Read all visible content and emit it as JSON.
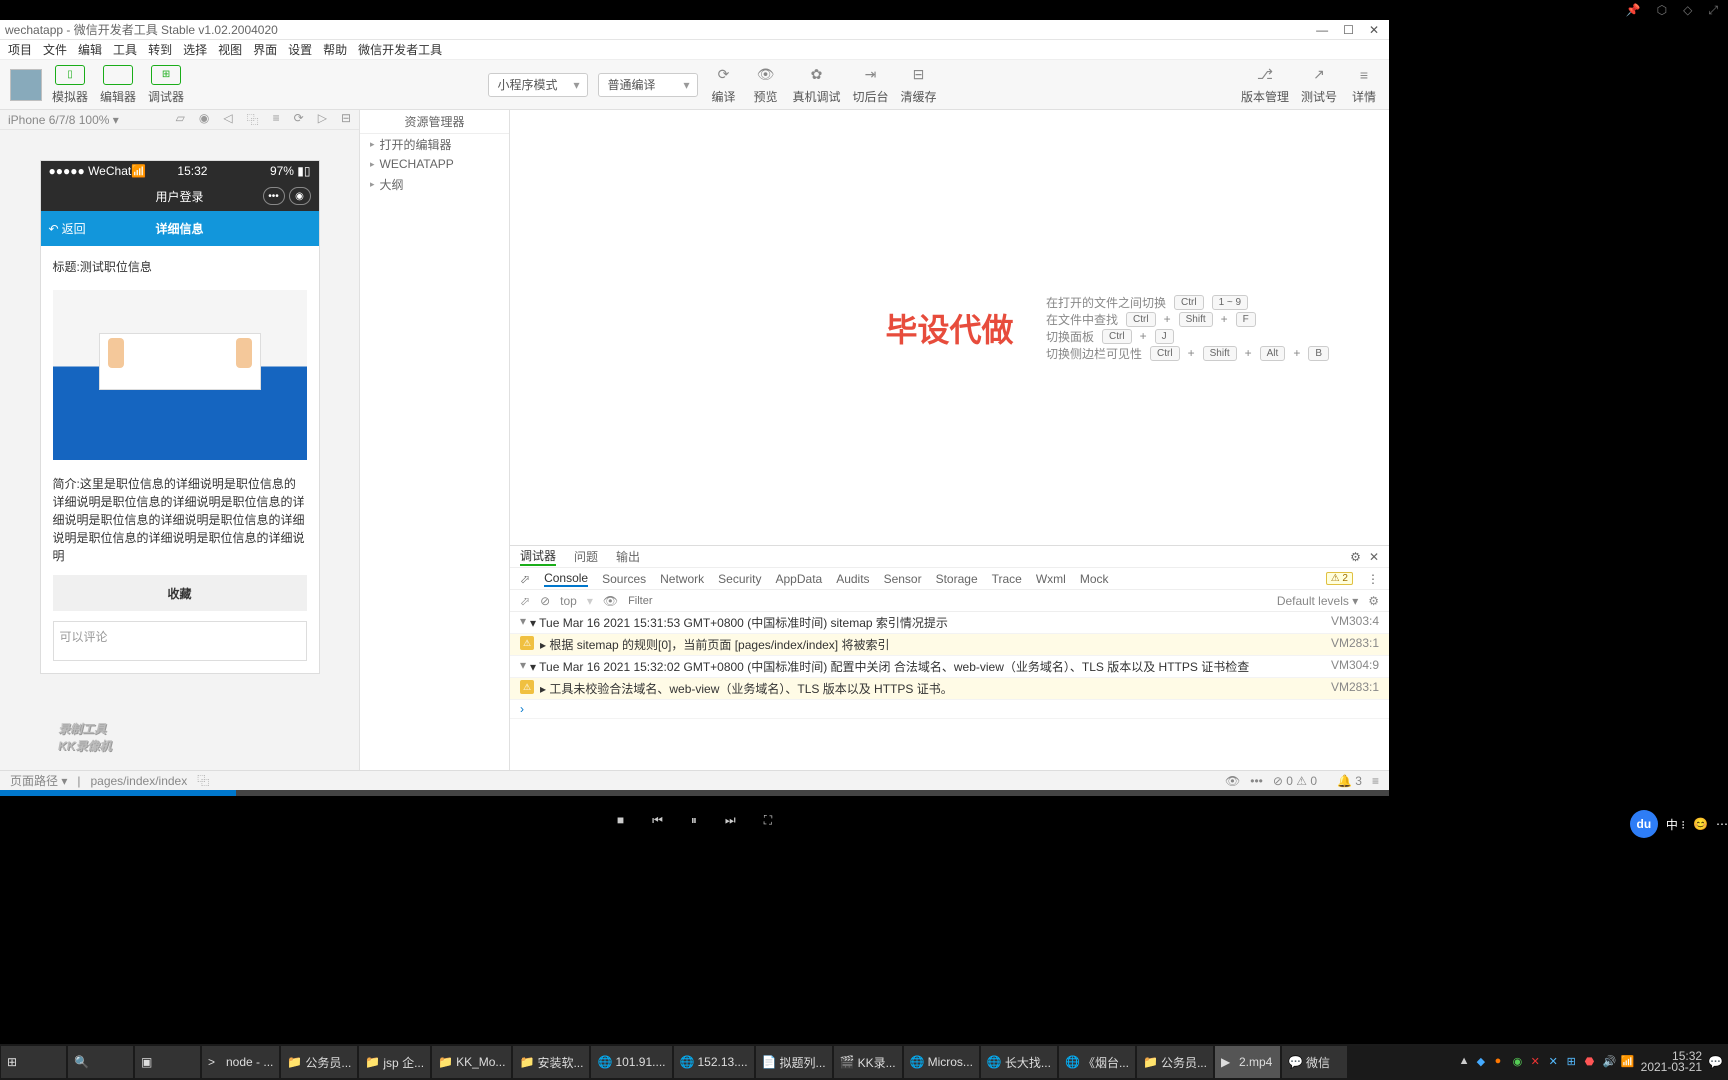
{
  "topbar_icons": [
    "📌",
    "⬡",
    "⬒",
    "↗"
  ],
  "titlebar": {
    "title": "wechatapp - 微信开发者工具 Stable v1.02.2004020"
  },
  "menubar": [
    "项目",
    "文件",
    "编辑",
    "工具",
    "转到",
    "选择",
    "视图",
    "界面",
    "设置",
    "帮助",
    "微信开发者工具"
  ],
  "toolbar_left": [
    {
      "icon": "▯",
      "label": "模拟器"
    },
    {
      "icon": "</>",
      "label": "编辑器"
    },
    {
      "icon": "⊞",
      "label": "调试器"
    }
  ],
  "mode_dd": "小程序模式",
  "compile_dd": "普通编译",
  "toolbar_mid": [
    {
      "icon": "⟳",
      "label": "编译"
    },
    {
      "icon": "👁",
      "label": "预览"
    },
    {
      "icon": "✿",
      "label": "真机调试"
    },
    {
      "icon": "⇥",
      "label": "切后台"
    },
    {
      "icon": "⊟",
      "label": "清缓存"
    }
  ],
  "toolbar_right": [
    {
      "icon": "⎇",
      "label": "版本管理"
    },
    {
      "icon": "↗",
      "label": "测试号"
    },
    {
      "icon": "≡",
      "label": "详情"
    }
  ],
  "sim": {
    "device": "iPhone 6/7/8 100% ▾"
  },
  "phone": {
    "carrier": "●●●●● WeChat📶",
    "time": "15:32",
    "battery": "97% ▮▯",
    "nav_title": "用户登录",
    "blue_back": "返回",
    "blue_title": "详细信息",
    "content_title": "标题:测试职位信息",
    "content_desc": "简介:这里是职位信息的详细说明是职位信息的详细说明是职位信息的详细说明是职位信息的详细说明是职位信息的详细说明是职位信息的详细说明是职位信息的详细说明是职位信息的详细说明",
    "fav": "收藏",
    "comment_ph": "可以评论"
  },
  "explorer": {
    "head": "资源管理器",
    "items": [
      "打开的编辑器",
      "WECHATAPP",
      "大纲"
    ]
  },
  "editor_hints": [
    {
      "text": "在打开的文件之间切换",
      "keys": [
        "Ctrl",
        "1 ~ 9"
      ]
    },
    {
      "text": "在文件中查找",
      "keys": [
        "Ctrl",
        "+",
        "Shift",
        "+",
        "F"
      ]
    },
    {
      "text": "切换面板",
      "keys": [
        "Ctrl",
        "+",
        "J"
      ]
    },
    {
      "text": "切换侧边栏可见性",
      "keys": [
        "Ctrl",
        "+",
        "Shift",
        "+",
        "Alt",
        "+",
        "B"
      ]
    }
  ],
  "watermark": "毕设代做",
  "debugger": {
    "tabs1": [
      "调试器",
      "问题",
      "输出"
    ],
    "tabs2": [
      "Console",
      "Sources",
      "Network",
      "Security",
      "AppData",
      "Audits",
      "Sensor",
      "Storage",
      "Trace",
      "Wxml",
      "Mock"
    ],
    "warn_count": "⚠ 2",
    "context": "top",
    "filter_ph": "Filter",
    "levels": "Default levels ▾",
    "logs": [
      {
        "type": "info",
        "msg": "▾ Tue Mar 16 2021 15:31:53 GMT+0800 (中国标准时间) sitemap 索引情况提示",
        "src": "VM303:4"
      },
      {
        "type": "warn",
        "msg": "▸ 根据 sitemap 的规则[0]，当前页面 [pages/index/index] 将被索引",
        "src": "VM283:1"
      },
      {
        "type": "info",
        "msg": "▾ Tue Mar 16 2021 15:32:02 GMT+0800 (中国标准时间) 配置中关闭 合法域名、web-view（业务域名）、TLS 版本以及 HTTPS 证书检查",
        "src": "VM304:9"
      },
      {
        "type": "warn",
        "msg": "▸ 工具未校验合法域名、web-view（业务域名）、TLS 版本以及 HTTPS 证书。",
        "src": "VM283:1"
      }
    ]
  },
  "statusbar": {
    "left": "页面路径 ▾",
    "path": "pages/index/index",
    "counts": "⊘ 0 ⚠ 0",
    "bell": "🔔 3"
  },
  "rec_watermark1": "录制工具",
  "rec_watermark2": "KK录像机",
  "video_ctrl": [
    "■",
    "⏮",
    "⏸",
    "⏭",
    "⛶"
  ],
  "float": {
    "du": "du",
    "ime": "中 ⁝",
    "emoji": "😊",
    "more": "⋯"
  },
  "taskbar": [
    {
      "ic": "⊞",
      "label": ""
    },
    {
      "ic": "🔍",
      "label": ""
    },
    {
      "ic": "▣",
      "label": ""
    },
    {
      "ic": ">",
      "label": "node - ..."
    },
    {
      "ic": "📁",
      "label": "公务员..."
    },
    {
      "ic": "📁",
      "label": "jsp 企..."
    },
    {
      "ic": "📁",
      "label": "KK_Mo..."
    },
    {
      "ic": "📁",
      "label": "安装软..."
    },
    {
      "ic": "🌐",
      "label": "101.91...."
    },
    {
      "ic": "🌐",
      "label": "152.13...."
    },
    {
      "ic": "📄",
      "label": "拟题列..."
    },
    {
      "ic": "🎬",
      "label": "KK录..."
    },
    {
      "ic": "🌐",
      "label": "Micros..."
    },
    {
      "ic": "🌐",
      "label": "长大找..."
    },
    {
      "ic": "🌐",
      "label": "《烟台..."
    },
    {
      "ic": "📁",
      "label": "公务员..."
    },
    {
      "ic": "▶",
      "label": "2.mp4",
      "active": true
    },
    {
      "ic": "💬",
      "label": "微信"
    }
  ],
  "tray": {
    "time": "15:32",
    "date": "2021-03-21"
  }
}
